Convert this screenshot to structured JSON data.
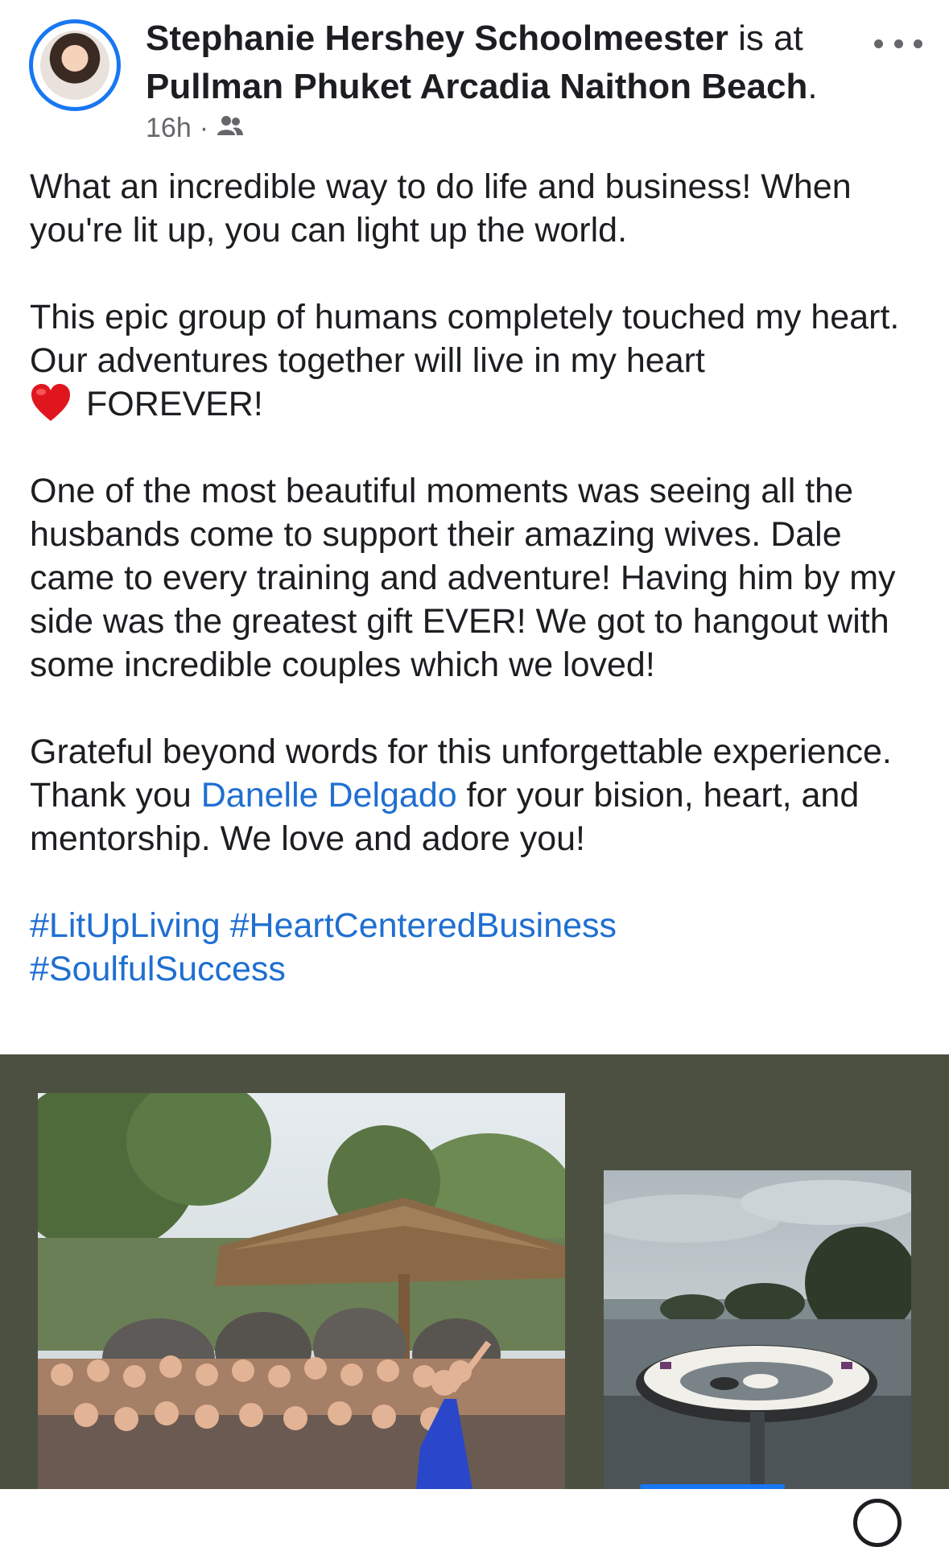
{
  "post": {
    "author_name": "Stephanie Hershey Schoolmeester",
    "is_at_text": " is at ",
    "location": "Pullman Phuket Arcadia Naithon Beach",
    "location_suffix": ".",
    "timestamp": "16h",
    "separator": "·",
    "audience_icon": "friends-icon",
    "more_icon": "more-options-icon",
    "paragraph1": "What an incredible way to do life and business! When you're lit up, you can light up the world.",
    "paragraph2": "This epic group of humans completely touched my heart. Our adventures together will live in my heart",
    "paragraph2_emoji": "red-heart-emoji",
    "paragraph2_end": "FOREVER!",
    "paragraph3": "One of the most beautiful moments was seeing all the husbands come to support their amazing wives. Dale came to every training and adventure! Having him by my side was the greatest gift EVER! We got to hangout with some incredible couples which we loved!",
    "paragraph4_before": "Grateful beyond words for this unforgettable experience.  Thank you ",
    "paragraph4_mention": "Danelle Delgado",
    "paragraph4_after": " for your bision, heart, and mentorship. We love and adore you!",
    "hashtags": [
      "#LitUpLiving",
      "#HeartCenteredBusiness",
      "#SoulfulSuccess"
    ]
  },
  "media": {
    "background_color": "#4c5041",
    "photos": [
      "group-photo-elephants",
      "infinity-pool-lounge-photo"
    ]
  },
  "colors": {
    "link": "#1f6fd1",
    "avatar_ring": "#1877f2",
    "secondary_text": "#65676b"
  }
}
